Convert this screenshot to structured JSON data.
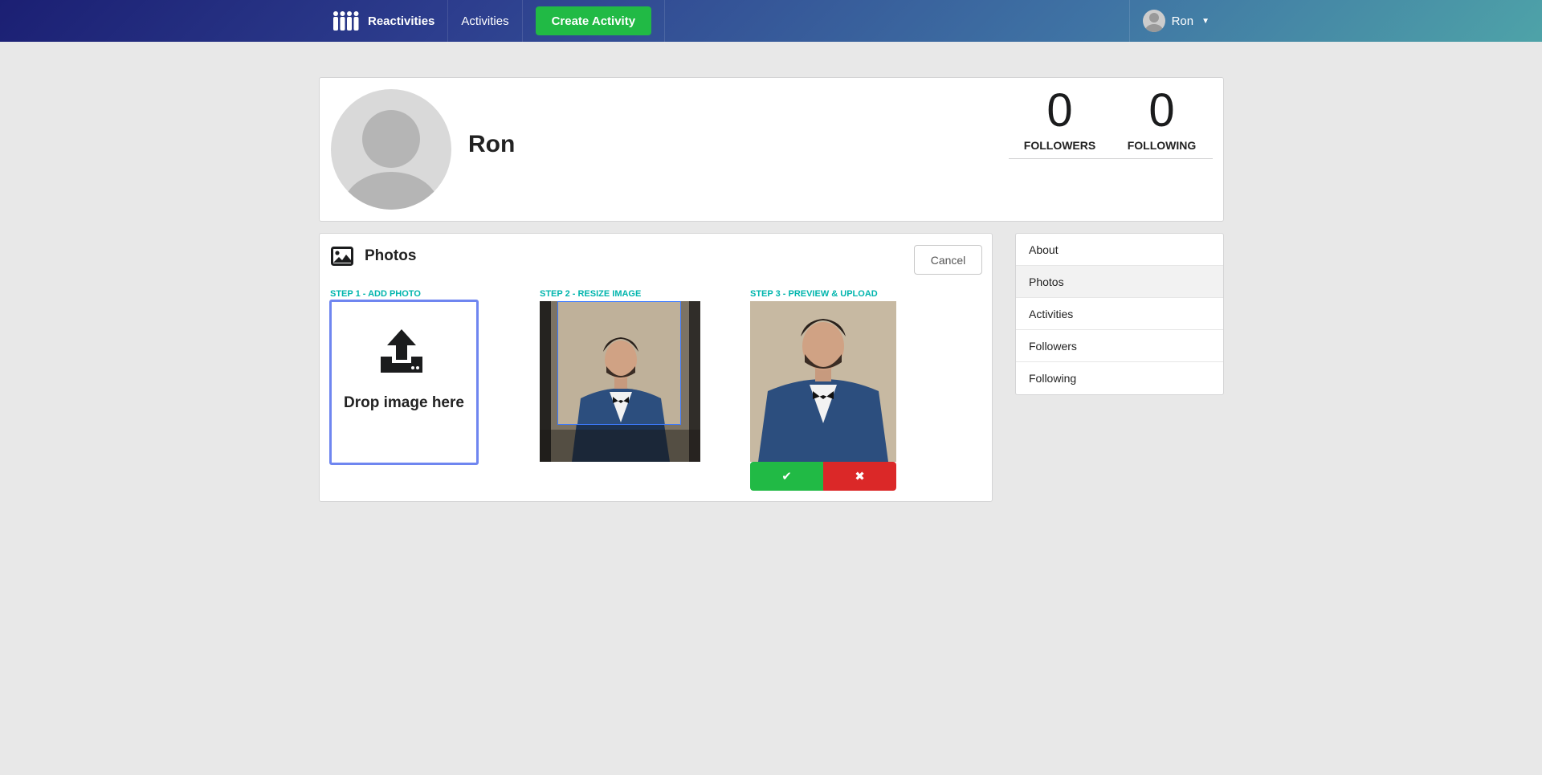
{
  "nav": {
    "brand": "Reactivities",
    "activities": "Activities",
    "create_activity": "Create Activity",
    "user_name": "Ron"
  },
  "profile": {
    "name": "Ron",
    "followers_count": "0",
    "followers_label": "FOLLOWERS",
    "following_count": "0",
    "following_label": "FOLLOWING"
  },
  "photos": {
    "title": "Photos",
    "cancel": "Cancel",
    "step1": "STEP 1 - ADD PHOTO",
    "step2": "STEP 2 - RESIZE IMAGE",
    "step3": "STEP 3 - PREVIEW & UPLOAD",
    "drop_text": "Drop image here"
  },
  "menu": {
    "items": [
      "About",
      "Photos",
      "Activities",
      "Followers",
      "Following"
    ],
    "active": "Photos"
  },
  "colors": {
    "accent_green": "#21ba45",
    "accent_red": "#db2828",
    "step_teal": "#00b5ad",
    "dropzone_outline": "#6f86f0"
  }
}
